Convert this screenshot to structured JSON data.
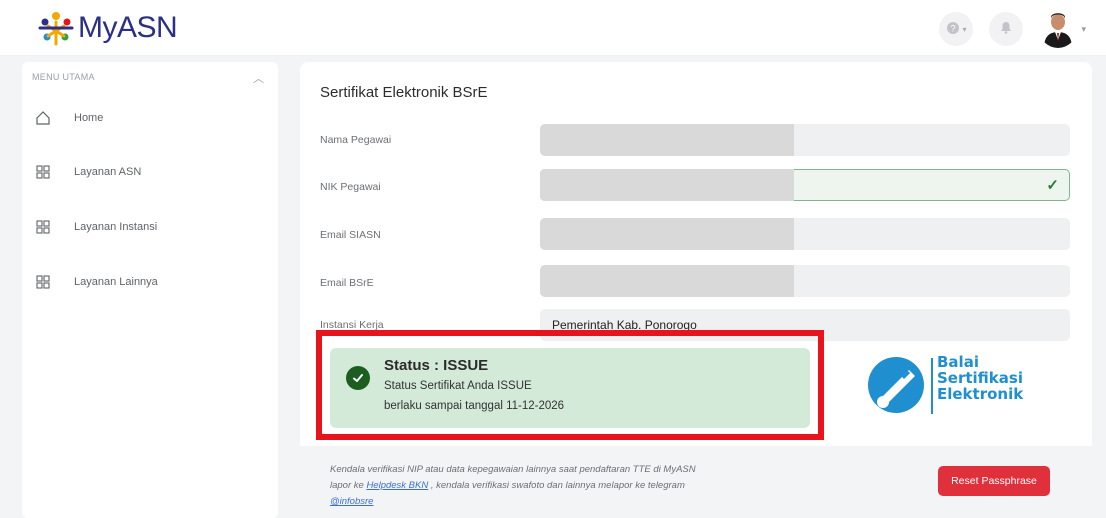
{
  "header": {
    "logo_my": "My",
    "logo_asn": "ASN",
    "help_icon": "question-icon",
    "notification_icon": "bell-icon",
    "avatar_icon": "user-avatar"
  },
  "sidebar": {
    "heading": "MENU UTAMA",
    "collapse_icon": "chevron-up-icon",
    "items": [
      {
        "label": "Home",
        "icon": "home-icon"
      },
      {
        "label": "Layanan ASN",
        "icon": "grid-icon"
      },
      {
        "label": "Layanan Instansi",
        "icon": "grid-icon"
      },
      {
        "label": "Layanan Lainnya",
        "icon": "grid-icon"
      }
    ]
  },
  "main": {
    "title": "Sertifikat Elektronik BSrE",
    "fields": [
      {
        "label": "Nama Pegawai",
        "value": ""
      },
      {
        "label": "NIK Pegawai",
        "value": "",
        "valid": true
      },
      {
        "label": "Email SIASN",
        "value": ""
      },
      {
        "label": "Email BSrE",
        "value": ""
      },
      {
        "label": "Instansi Kerja",
        "value": "Pemerintah Kab. Ponorogo"
      }
    ],
    "status": {
      "title": "Status : ISSUE",
      "line1_prefix": "Status Sertifikat Anda ",
      "line1_strong": "ISSUE",
      "line2": "berlaku sampai tanggal 11-12-2026"
    },
    "bsre_logo": {
      "line1": "Balai",
      "line2": "Sertifikasi",
      "line3": "Elektronik"
    },
    "note": {
      "part1": "Kendala verifikasi NIP atau data kepegawaian lainnya saat pendaftaran TTE di MyASN lapor ke ",
      "link1": "Helpdesk BKN",
      "part2": " , kendala verifikasi swafoto dan lainnya melapor ke telegram ",
      "link2": "@infobsre"
    },
    "reset_button": "Reset Passphrase"
  },
  "colors": {
    "brand": "#2b2f86",
    "status_bg": "#d4ead9",
    "status_icon": "#1b5e20",
    "highlight": "#e8141b",
    "danger": "#e0303c",
    "bsre": "#1f8fcf"
  }
}
